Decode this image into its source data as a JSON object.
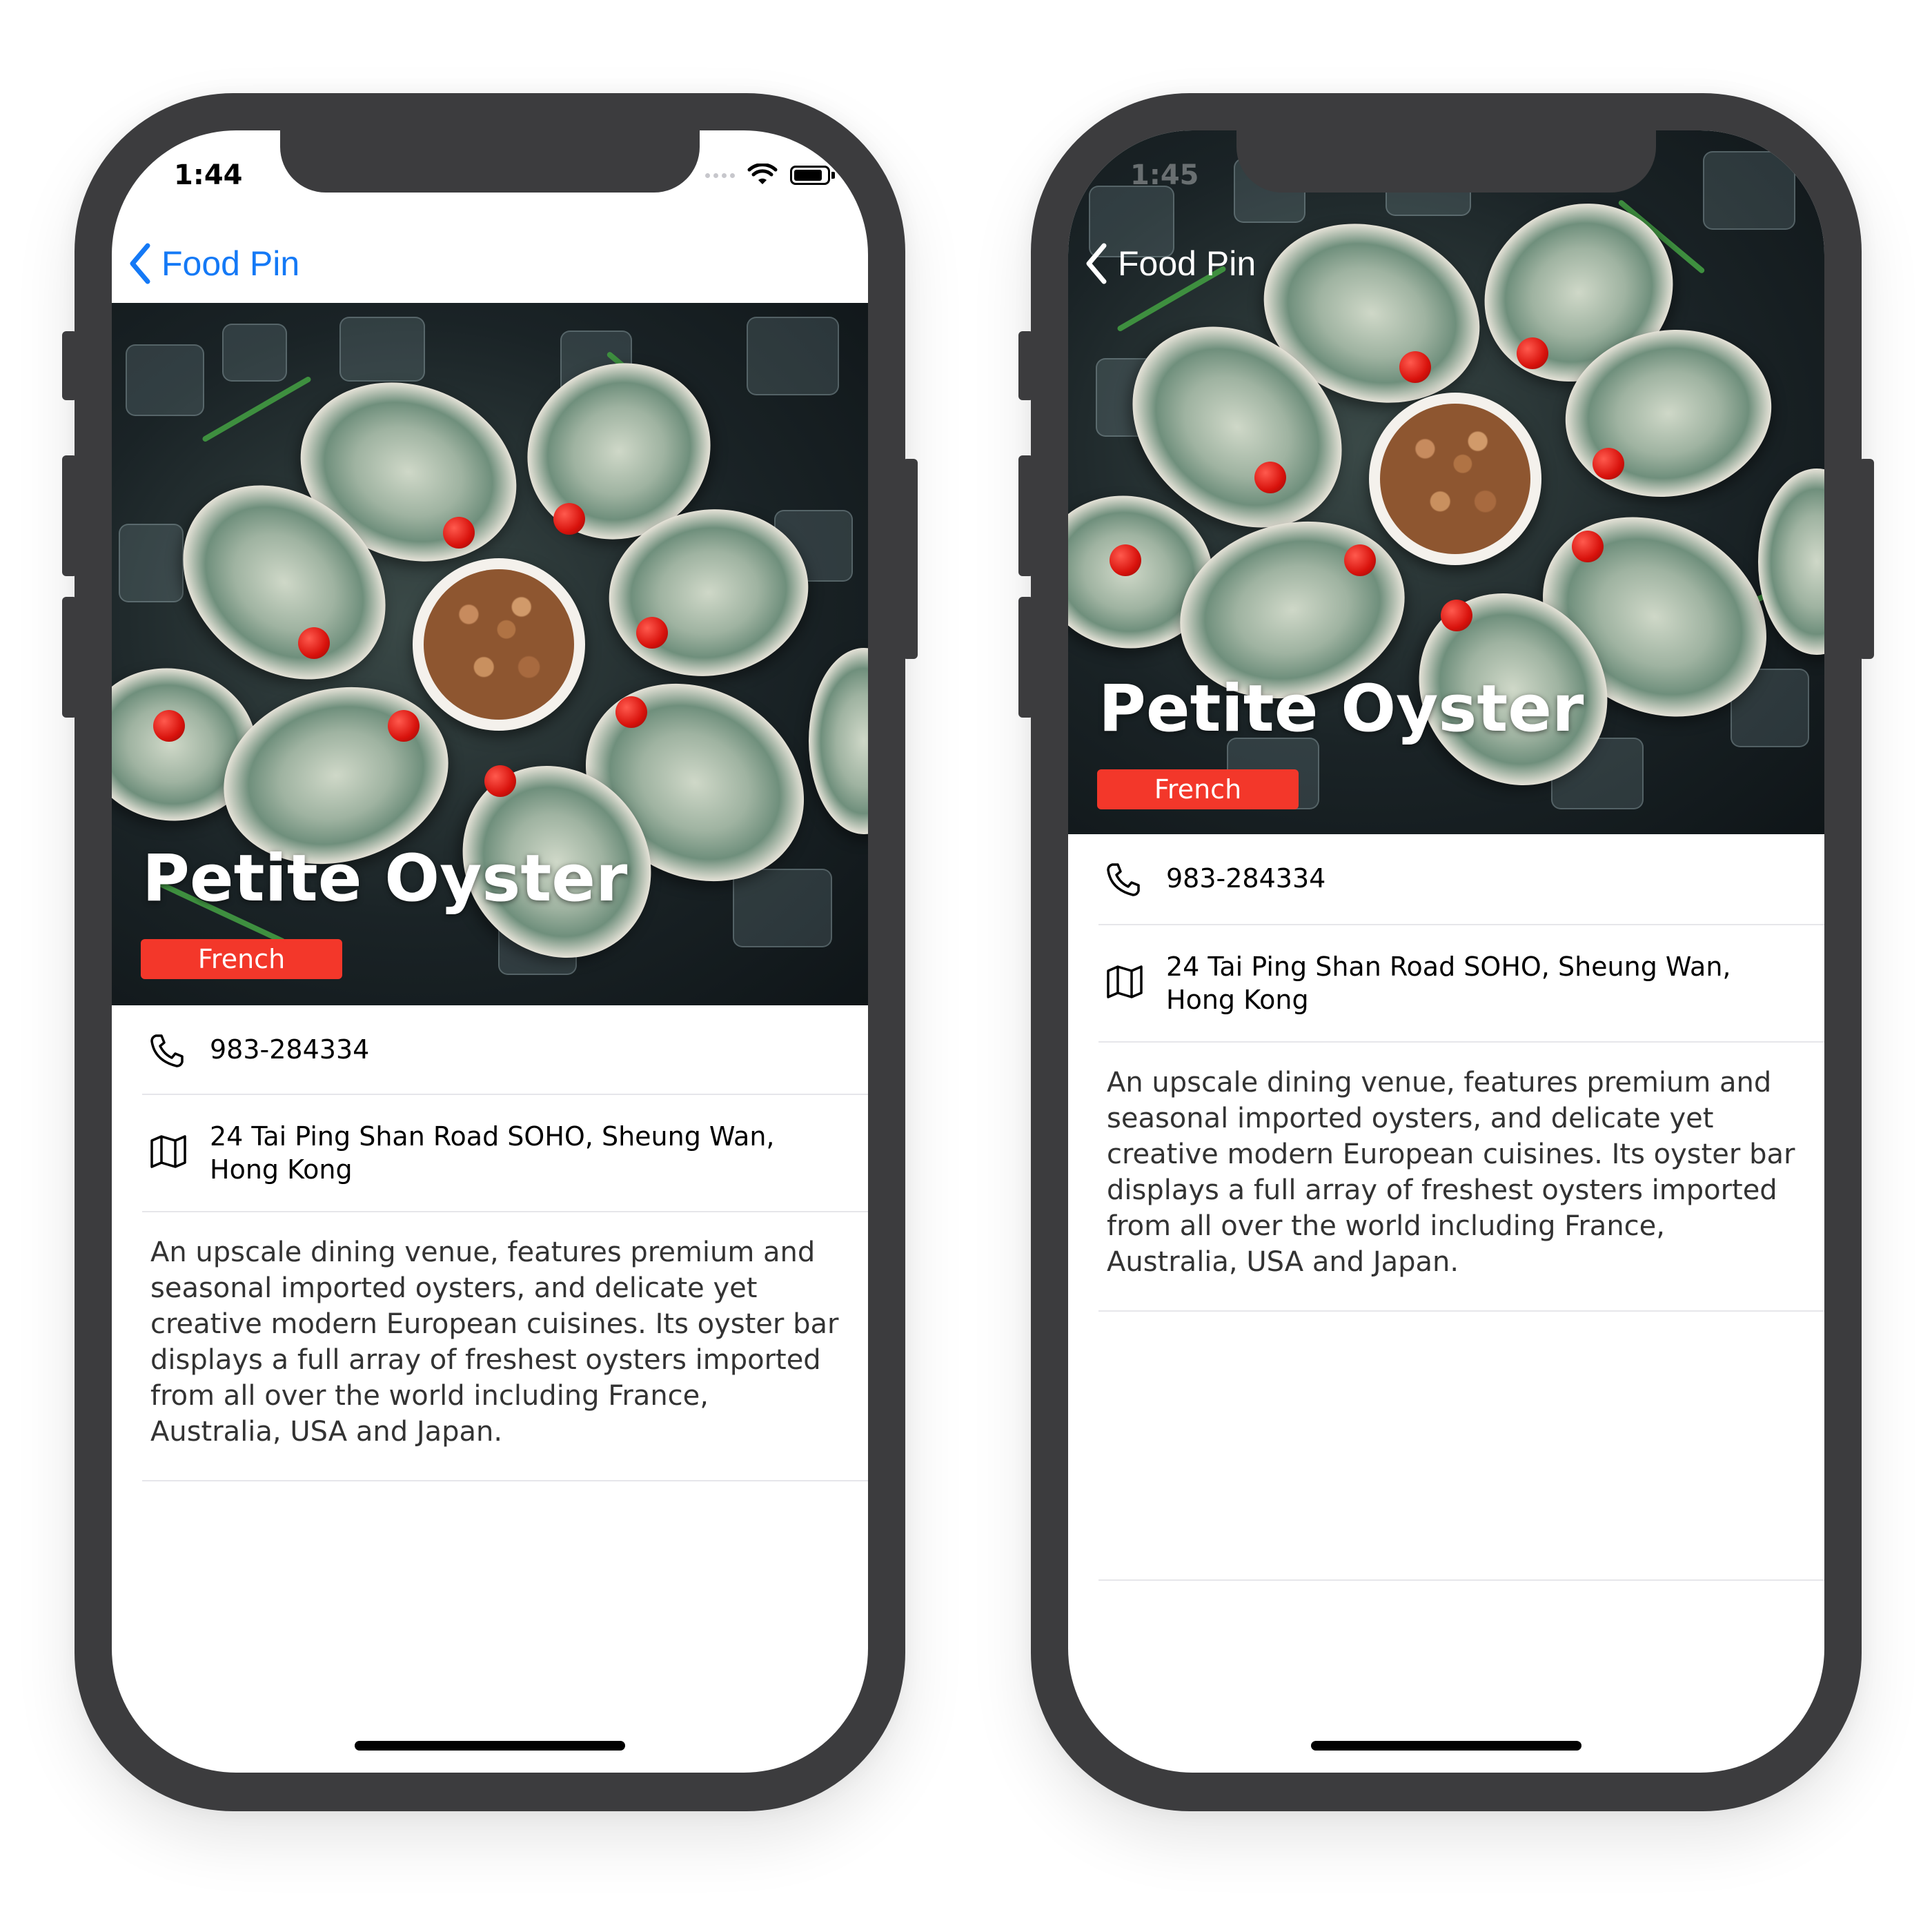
{
  "left": {
    "status": {
      "time": "1:44"
    },
    "nav": {
      "back_label": "Food Pin"
    },
    "restaurant": {
      "name": "Petite Oyster",
      "type": "French",
      "phone": "983-284334",
      "address": "24 Tai Ping Shan Road SOHO, Sheung Wan, Hong Kong",
      "description": "An upscale dining venue, features premium and seasonal imported oysters, and delicate yet creative modern European cuisines. Its oyster bar displays a full array of freshest oysters imported from all over the world including France, Australia, USA and Japan."
    }
  },
  "right": {
    "status": {
      "time": "1:45"
    },
    "nav": {
      "back_label": "Food Pin"
    },
    "restaurant": {
      "name": "Petite Oyster",
      "type": "French",
      "phone": "983-284334",
      "address": "24 Tai Ping Shan Road SOHO, Sheung Wan, Hong Kong",
      "description": "An upscale dining venue, features premium and seasonal imported oysters, and delicate yet creative modern European cuisines. Its oyster bar displays a full array of freshest oysters imported from all over the world including France, Australia, USA and Japan."
    }
  },
  "colors": {
    "accent": "#1479f6",
    "badge": "#f3372a",
    "frame": "#3c3c3e"
  },
  "icons": {
    "back": "chevron-left-icon",
    "phone": "phone-icon",
    "map": "map-icon",
    "wifi": "wifi-icon",
    "battery": "battery-icon"
  }
}
